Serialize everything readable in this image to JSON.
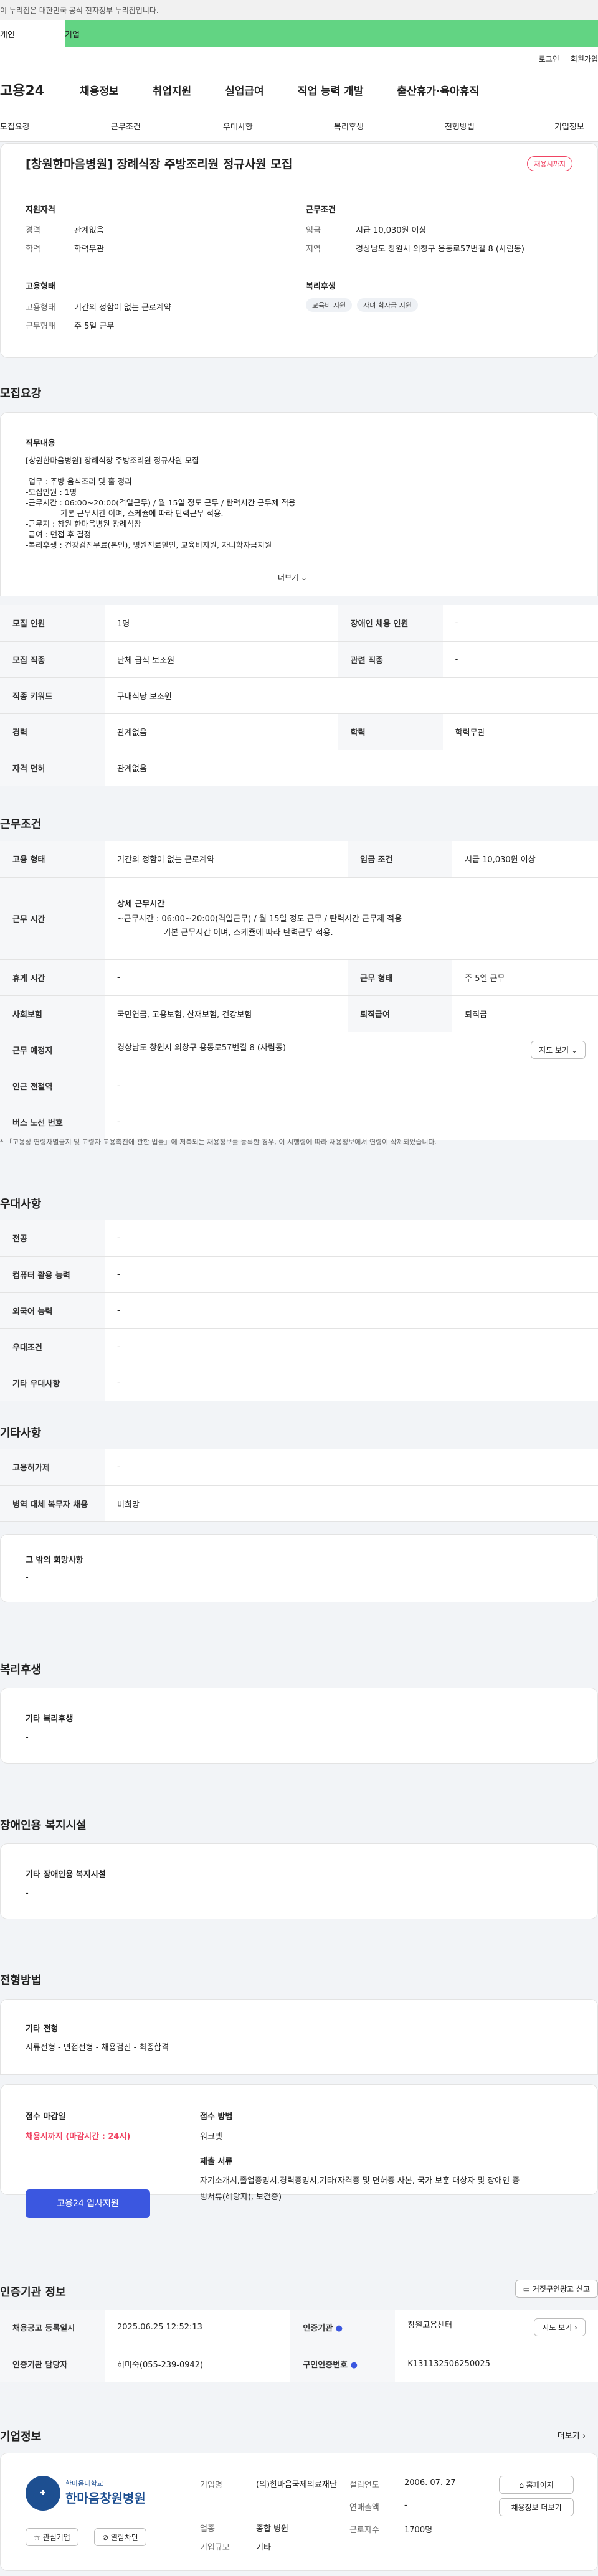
{
  "gov_banner": "이 누리집은 대한민국 공식 전자정부 누리집입니다.",
  "tabs": {
    "personal": "개인",
    "company": "기업"
  },
  "topbar": {
    "login": "로그인",
    "signup": "회원가입"
  },
  "logo": "고용24",
  "gnb": [
    "채용정보",
    "취업지원",
    "실업급여",
    "직업 능력 개발",
    "출산휴가·육아휴직"
  ],
  "lnb": [
    "모집요강",
    "근무조건",
    "우대사항",
    "복리후생",
    "전형방법",
    "기업정보"
  ],
  "summary": {
    "title": "[창원한마음병원] 장례식장 주방조리원 정규사원 모집",
    "badge": "채용시까지",
    "qual_title": "지원자격",
    "exp_label": "경력",
    "exp_val": "관계없음",
    "edu_label": "학력",
    "edu_val": "학력무관",
    "cond_title": "근무조건",
    "wage_label": "임금",
    "wage_val": "시급 10,030원 이상",
    "region_label": "지역",
    "region_val": "경상남도 창원시 의창구 용동로57번길 8 (사림동)",
    "emp_title": "고용형태",
    "emp_type_label": "고용형태",
    "emp_type_val": "기간의 정함이 없는 근로계약",
    "work_label": "근무형태",
    "work_val": "주 5일 근무",
    "welfare_title": "복리후생",
    "welfare_chips": [
      "교육비 지원",
      "자녀 학자금 지원"
    ]
  },
  "recruit": {
    "section": "모집요강",
    "duty_label": "직무내용",
    "duty_lines": [
      "[창원한마음병원] 장례식장 주방조리원 정규사원 모집",
      "",
      "-업무 : 주방 음식조리 및 홀 정리",
      "-모집인원 : 1명",
      "-근무시간 : 06:00~20:00(격일근무) / 월 15일 정도 근무 / 탄력시간 근무제 적용",
      "              기본 근무시간 이며, 스케쥴에 따라 탄력근무 적용.",
      "-근무지 : 창원 한마음병원 장례식장",
      "-급여 : 면접 후 결정",
      "-복리후생 : 건강검진무료(본인), 병원진료할인, 교육비지원, 자녀학자금지원"
    ],
    "more": "더보기",
    "rows": [
      {
        "h1": "모집 인원",
        "v1": "1명",
        "h2": "장애인 채용 인원",
        "v2": "-"
      },
      {
        "h1": "모집 직종",
        "v1": "단체 급식 보조원",
        "h2": "관련 직종",
        "v2": "-"
      },
      {
        "h1": "직종 키워드",
        "v1": "구내식당 보조원"
      },
      {
        "h1": "경력",
        "v1": "관계없음",
        "h2": "학력",
        "v2": "학력무관"
      },
      {
        "h1": "자격 면허",
        "v1": "관계없음"
      }
    ]
  },
  "workcond": {
    "section": "근무조건",
    "emp_h": "고용 형태",
    "emp_v": "기간의 정함이 없는 근로계약",
    "wage_h": "임금 조건",
    "wage_v": "시급 10,030원 이상",
    "time_h": "근무 시간",
    "time_sub": "상세 근무시간",
    "time_lines": [
      "~근무시간 : 06:00~20:00(격일근무) / 월 15일 정도 근무 / 탄력시간 근무제 적용",
      "                  기본 근무시간 이며, 스케쥴에 따라 탄력근무 적용."
    ],
    "rest_h": "휴게 시간",
    "rest_v": "-",
    "form_h": "근무 형태",
    "form_v": "주 5일 근무",
    "ins_h": "사회보험",
    "ins_v": "국민연금, 고용보험, 산재보험, 건강보험",
    "sev_h": "퇴직급여",
    "sev_v": "퇴직금",
    "place_h": "근무 예정지",
    "place_v": "경상남도 창원시 의창구 용동로57번길 8 (사림동)",
    "map_btn": "지도 보기",
    "subway_h": "인근 전철역",
    "subway_v": "-",
    "bus_h": "버스 노선 번호",
    "bus_v": "-",
    "note": "* 「고용상 연령차별금지 및 고령자 고용촉진에 관한 법률」에 저촉되는 채용정보를 등록한 경우, 이 시행령에 따라 채용정보에서 연령이 삭제되었습니다."
  },
  "pref": {
    "section": "우대사항",
    "rows": [
      [
        "전공",
        "-"
      ],
      [
        "컴퓨터 활용 능력",
        "-"
      ],
      [
        "외국어 능력",
        "-"
      ],
      [
        "우대조건",
        "-"
      ],
      [
        "기타 우대사항",
        "-"
      ]
    ]
  },
  "etc": {
    "section": "기타사항",
    "rows": [
      [
        "고용허가제",
        "-"
      ],
      [
        "병역 대체 복무자 채용",
        "비희망"
      ]
    ],
    "hope_label": "그 밖의 희망사항",
    "hope_val": "-"
  },
  "welfare": {
    "section": "복리후생",
    "label": "기타 복리후생",
    "val": "-"
  },
  "disab": {
    "section": "장애인용 복지시설",
    "label": "기타 장애인용 복지시설",
    "val": "-"
  },
  "screen": {
    "section": "전형방법",
    "label": "기타 전형",
    "val": "서류전형 - 면접전형 - 채용검진 - 최종합격",
    "deadline_label": "접수 마감일",
    "deadline_val": "채용시까지 (마감시간 : 24시)",
    "apply_btn": "고용24 입사지원",
    "method_label": "접수 방법",
    "method_val": "워크넷",
    "docs_label": "제출 서류",
    "docs_lines": [
      "자기소개서,졸업증명서,경력증명서,기타(자격증 및 면허증 사본, 국가 보훈 대상자 및 장애인 증",
      "빙서류(해당자), 보건증)"
    ]
  },
  "cert": {
    "section": "인증기관 정보",
    "report_btn": "거짓구인광고 신고",
    "reg_h": "채용공고 등록일시",
    "reg_v": "2025.06.25 12:52:13",
    "org_h": "인증기관",
    "org_v": "창원고용센터",
    "map_btn": "지도 보기",
    "mgr_h": "인증기관 담당자",
    "mgr_v": "허미숙(055-239-0942)",
    "no_h": "구인인증번호",
    "no_v": "K131132506250025"
  },
  "company": {
    "section": "기업정보",
    "more": "더보기",
    "logo_line1": "한마음대학교",
    "logo_line2": "한마음창원병원",
    "fav_btn": "관심기업",
    "block_btn": "열람차단",
    "name_h": "기업명",
    "name_v": "(의)한마음국제의료재단",
    "est_h": "설립연도",
    "est_v": "2006. 07. 27",
    "sales_h": "연매출액",
    "sales_v": "-",
    "ind_h": "업종",
    "ind_v": "종합 병원",
    "staff_h": "근로자수",
    "staff_v": "1700명",
    "scale_h": "기업규모",
    "scale_v": "기타",
    "home_btn": "홈페이지",
    "list_btn": "채용정보 더보기"
  }
}
